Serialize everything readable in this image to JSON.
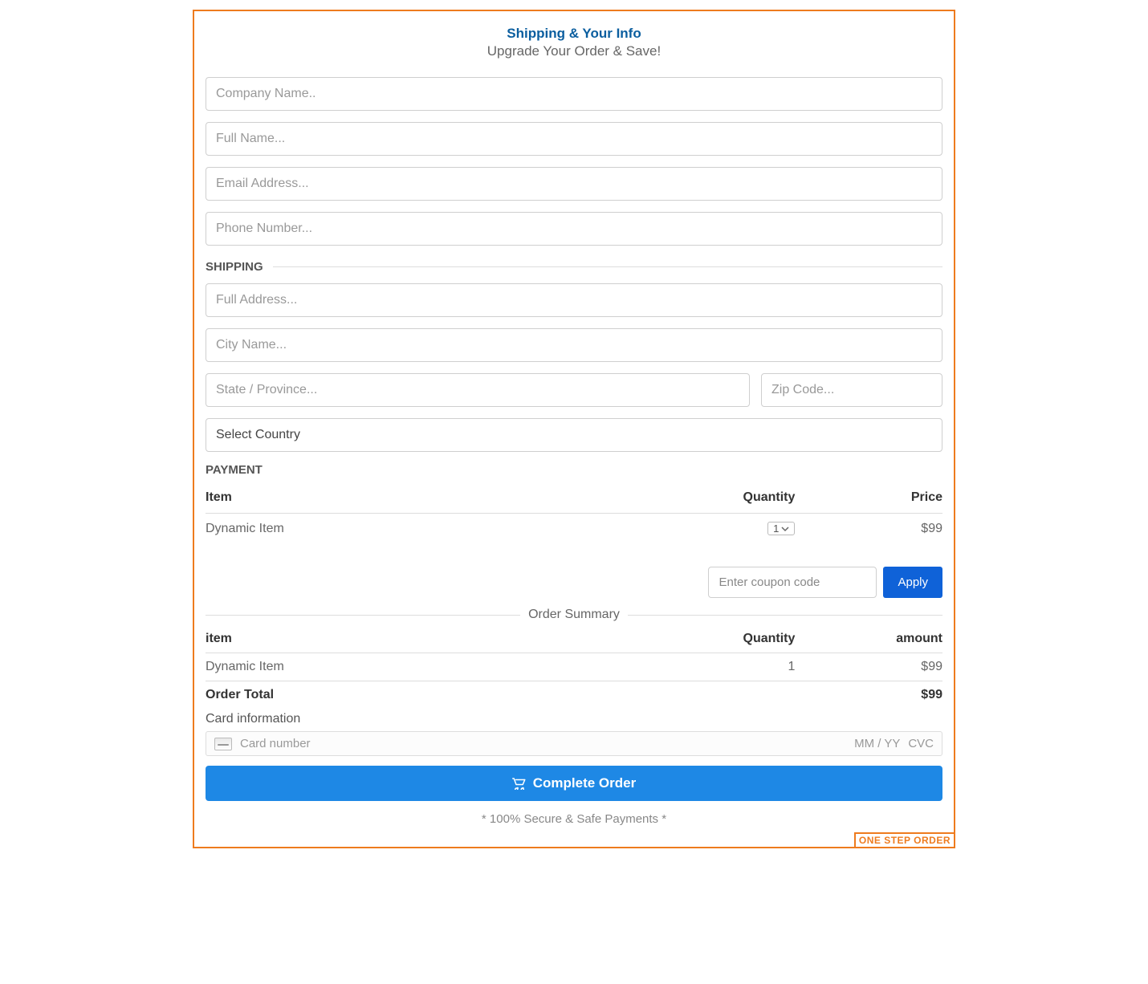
{
  "header": {
    "title": "Shipping & Your Info",
    "subtitle": "Upgrade Your Order & Save!"
  },
  "info": {
    "company_placeholder": "Company Name..",
    "fullname_placeholder": "Full Name...",
    "email_placeholder": "Email Address...",
    "phone_placeholder": "Phone Number..."
  },
  "shipping": {
    "section_label": "SHIPPING",
    "address_placeholder": "Full Address...",
    "city_placeholder": "City Name...",
    "state_placeholder": "State / Province...",
    "zip_placeholder": "Zip Code...",
    "country_placeholder": "Select Country"
  },
  "payment": {
    "section_label": "PAYMENT",
    "columns": {
      "item": "Item",
      "quantity": "Quantity",
      "price": "Price"
    },
    "row": {
      "item": "Dynamic Item",
      "quantity_value": "1",
      "price": "$99"
    }
  },
  "coupon": {
    "placeholder": "Enter coupon code",
    "apply_label": "Apply"
  },
  "summary": {
    "title": "Order Summary",
    "columns": {
      "item": "item",
      "quantity": "Quantity",
      "amount": "amount"
    },
    "row": {
      "item": "Dynamic Item",
      "quantity": "1",
      "amount": "$99"
    },
    "total": {
      "label": "Order Total",
      "amount": "$99"
    }
  },
  "card": {
    "label": "Card information",
    "number_placeholder": "Card number",
    "exp_placeholder": "MM / YY",
    "cvc_placeholder": "CVC"
  },
  "complete": {
    "label": "Complete Order"
  },
  "footer": {
    "secure_text": "* 100% Secure & Safe Payments *",
    "badge": "ONE STEP ORDER"
  }
}
